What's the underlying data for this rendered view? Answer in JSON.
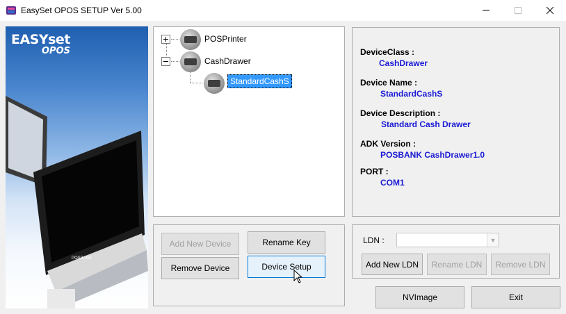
{
  "window": {
    "title": "EasySet OPOS SETUP Ver 5.00",
    "app_icon": "easyset-app-icon",
    "controls": {
      "minimize": "—",
      "maximize": "☐",
      "close": "✕"
    }
  },
  "promo": {
    "logo_main": "EASYset",
    "logo_sub": "OPOS",
    "device_brand": "POSBANK"
  },
  "tree": {
    "nodes": [
      {
        "label": "POSPrinter",
        "expander": "plus",
        "icon": "printer-icon"
      },
      {
        "label": "CashDrawer",
        "expander": "minus",
        "icon": "cash-drawer-icon"
      },
      {
        "label": "StandardCashS",
        "icon": "cash-drawer-icon",
        "selected": true
      }
    ]
  },
  "info": {
    "fields": [
      {
        "label": "DeviceClass :",
        "value": "CashDrawer"
      },
      {
        "label": "Device Name :",
        "value": "StandardCashS"
      },
      {
        "label": "Device Description :",
        "value": "Standard Cash Drawer"
      },
      {
        "label": "ADK Version :",
        "value": "POSBANK CashDrawer1.0"
      },
      {
        "label": "PORT :",
        "value": "COM1"
      }
    ]
  },
  "buttons": {
    "add_new_device": "Add New Device",
    "rename_key": "Rename Key",
    "remove_device": "Remove Device",
    "device_setup": "Device Setup",
    "add_new_ldn": "Add New LDN",
    "rename_ldn": "Rename LDN",
    "remove_ldn": "Remove LDN",
    "nvimage": "NVImage",
    "exit": "Exit"
  },
  "ldn": {
    "label": "LDN :",
    "selected_value": ""
  }
}
